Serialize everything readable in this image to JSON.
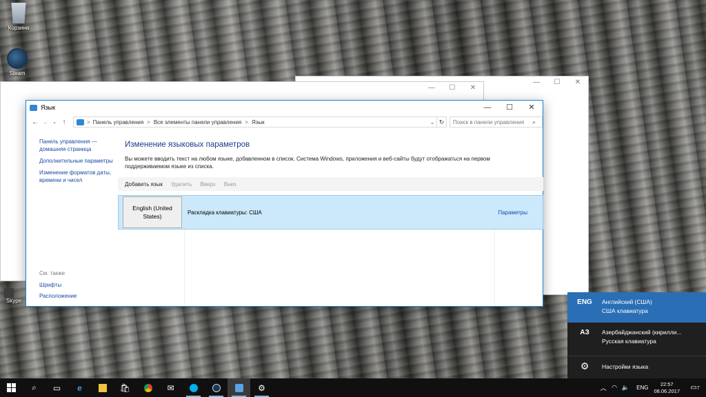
{
  "desktop": {
    "icons": [
      {
        "label": "Корзина"
      },
      {
        "label": "Steam"
      },
      {
        "label": "Skype"
      }
    ]
  },
  "window": {
    "title": "Язык",
    "controls": {
      "minimize": "—",
      "maximize": "☐",
      "close": "✕"
    },
    "address": {
      "crumbs": [
        "Панель управления",
        "Все элементы панели управления",
        "Язык"
      ],
      "separator": ">"
    },
    "search": {
      "placeholder": "Поиск в панели управления"
    },
    "left_pane": {
      "links": [
        "Панель управления — домашняя страница",
        "Дополнительные параметры",
        "Изменение форматов даты, времени и чисел"
      ],
      "see_also_header": "См. также",
      "see_also_links": [
        "Шрифты",
        "Расположение"
      ]
    },
    "main": {
      "heading": "Изменение языковых параметров",
      "description": "Вы можете вводить текст на любом языке, добавленном в список. Система Windows, приложения и веб-сайты будут отображаться на первом поддерживаемом языке из списка.",
      "toolbar": {
        "add": "Добавить язык",
        "remove": "Удалить",
        "up": "Вверх",
        "down": "Вниз"
      },
      "languages": [
        {
          "name": "English (United States)",
          "layout": "Раскладка клавиатуры: США",
          "options": "Параметры"
        }
      ]
    }
  },
  "flyout": {
    "items": [
      {
        "code": "ENG",
        "line1": "Английский (США)",
        "line2": "США клавиатура"
      },
      {
        "code": "АЗ",
        "line1": "Азербайджанский (кирилли...",
        "line2": "Русская клавиатура"
      }
    ],
    "settings_label": "Настройки языка"
  },
  "taskbar": {
    "lang": "ENG",
    "time": "22:57",
    "date": "08.06.2017",
    "notifications": "7"
  }
}
